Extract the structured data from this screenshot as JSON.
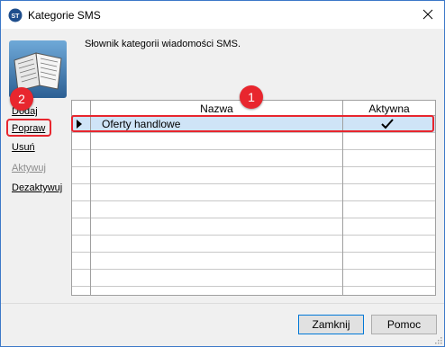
{
  "window": {
    "title": "Kategorie SMS",
    "app_icon": "app-logo-icon",
    "close_icon": "close-icon"
  },
  "header": {
    "icon": "book-icon",
    "description": "Słownik kategorii wiadomości SMS."
  },
  "menu": {
    "items": [
      {
        "label": "Dodaj",
        "enabled": true
      },
      {
        "label": "Popraw",
        "enabled": true
      },
      {
        "label": "Usuń",
        "enabled": true
      },
      {
        "label": "Aktywuj",
        "enabled": false
      },
      {
        "label": "Dezaktywuj",
        "enabled": true
      }
    ]
  },
  "grid": {
    "columns": [
      "Nazwa",
      "Aktywna"
    ],
    "rows": [
      {
        "name": "Oferty handlowe",
        "active": true,
        "selected": true
      }
    ],
    "active_icon": "checkmark-icon",
    "row_indicator_icon": "row-pointer-icon"
  },
  "annotations": {
    "badge1": "1",
    "badge2": "2",
    "color": "#e8262e"
  },
  "footer": {
    "close_label": "Zamknij",
    "help_label": "Pomoc"
  }
}
